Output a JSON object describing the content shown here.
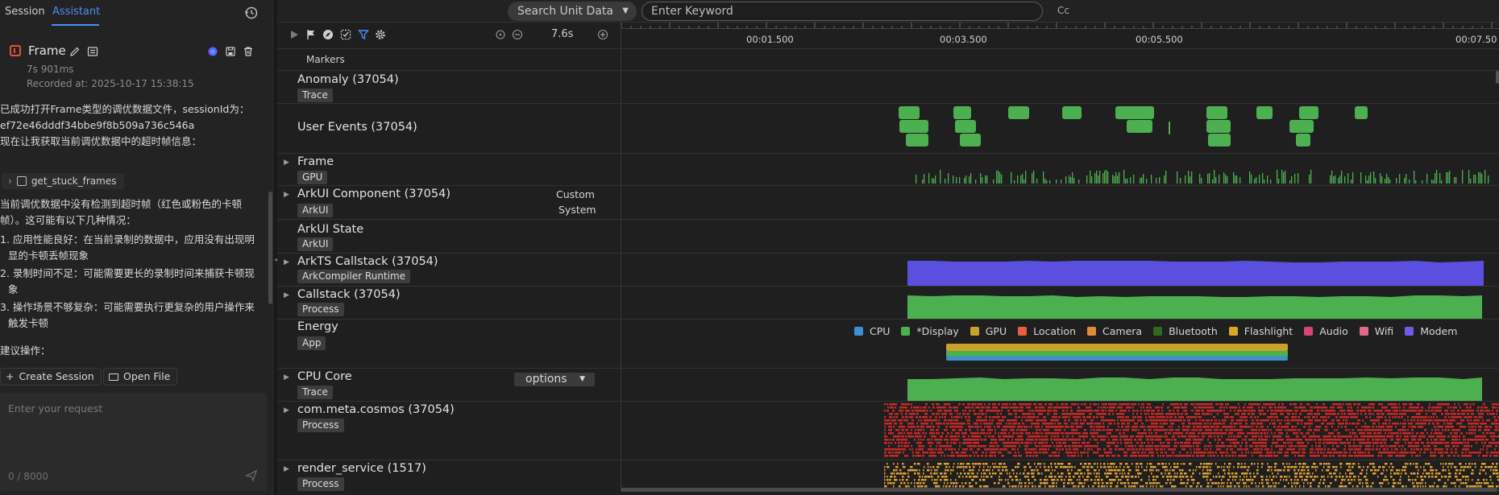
{
  "left": {
    "tabs": [
      {
        "label": "Session"
      },
      {
        "label": "Assistant"
      }
    ],
    "frame": {
      "title": "Frame",
      "duration": "7s 901ms",
      "recorded": "Recorded at: 2025-10-17 15:38:15"
    },
    "chat": {
      "lines": [
        "已成功打开Frame类型的调优数据文件，sessionId为：",
        "ef72e46dddf34bbe9f8b509a736c546a",
        "现在让我获取当前调优数据中的超时帧信息："
      ],
      "tool_name": "get_stuck_frames",
      "result_lines": [
        "当前调优数据中没有检测到超时帧（红色或粉色的卡顿",
        "帧）。这可能有以下几种情况：",
        "1. 应用性能良好：在当前录制的数据中，应用没有出现明",
        "显的卡顿丢帧现象",
        "2. 录制时间不足：可能需要更长的录制时间来捕获卡顿现",
        "象",
        "3. 操作场景不够复杂：可能需要执行更复杂的用户操作来",
        "触发卡顿",
        "建议操作："
      ]
    },
    "actions": {
      "create_session": "Create Session",
      "open_file": "Open File"
    },
    "request": {
      "placeholder": "Enter your request",
      "counter": "0 / 8000"
    }
  },
  "right": {
    "search": {
      "unit": "Search Unit Data",
      "keyword_placeholder": "Enter Keyword",
      "case_label": "Cc"
    },
    "toolbar": {
      "zoom": "7.6s"
    },
    "ruler": {
      "ticks": [
        "00:01.500",
        "00:03.500",
        "00:05.500",
        "00:07.50"
      ]
    },
    "markers_label": "Markers",
    "rows": {
      "anomaly": {
        "name": "Anomaly (37054)",
        "tag": "Trace"
      },
      "user_events": {
        "name": "User Events (37054)"
      },
      "frame": {
        "name": "Frame",
        "tag": "GPU"
      },
      "arkui_component": {
        "name": "ArkUI Component (37054)",
        "tag": "ArkUI",
        "custom": "Custom",
        "system": "System"
      },
      "arkui_state": {
        "name": "ArkUI State",
        "tag": "ArkUI"
      },
      "arkts": {
        "name": "ArkTS Callstack (37054)",
        "tag": "ArkCompiler Runtime"
      },
      "callstack": {
        "name": "Callstack (37054)",
        "tag": "Process"
      },
      "energy": {
        "name": "Energy",
        "tag": "App"
      },
      "cpu_core": {
        "name": "CPU Core",
        "tag": "Trace",
        "options": "options"
      },
      "cosmos": {
        "name": "com.meta.cosmos (37054)",
        "tag": "Process"
      },
      "render": {
        "name": "render_service (1517)",
        "tag": "Process"
      }
    },
    "energy_legend": [
      {
        "label": "CPU",
        "color": "#3d8fd6"
      },
      {
        "label": "*Display",
        "color": "#4caf50"
      },
      {
        "label": "GPU",
        "color": "#c9a227"
      },
      {
        "label": "Location",
        "color": "#e0613b"
      },
      {
        "label": "Camera",
        "color": "#e08a3b"
      },
      {
        "label": "Bluetooth",
        "color": "#2e6b1f"
      },
      {
        "label": "Flashlight",
        "color": "#d9a52b"
      },
      {
        "label": "Audio",
        "color": "#d6457a"
      },
      {
        "label": "Wifi",
        "color": "#e06a8a"
      },
      {
        "label": "Modem",
        "color": "#6c5ce7"
      }
    ],
    "colors": {
      "green": "#4caf50",
      "purple": "#5b4fe0",
      "red": "#c62828",
      "orange": "#e0a030",
      "accent": "#4b8dff"
    }
  }
}
